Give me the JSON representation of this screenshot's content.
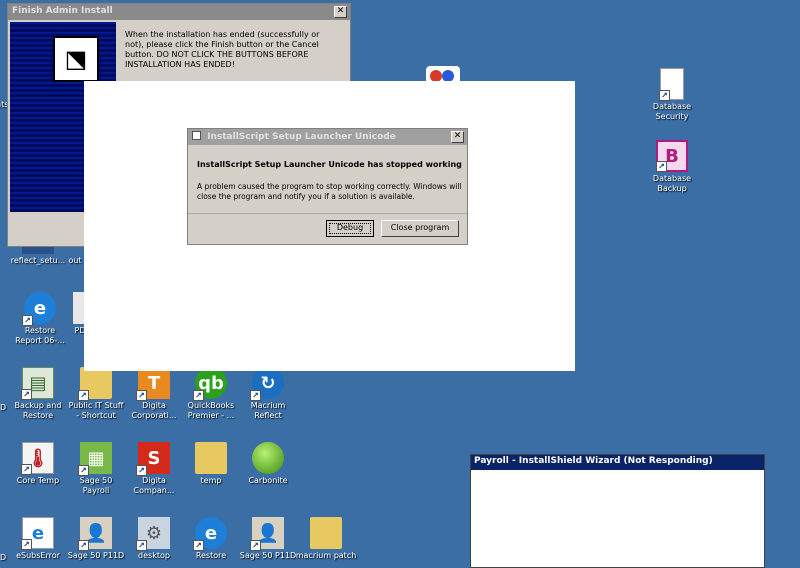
{
  "finish_window": {
    "title": "Finish Admin Install",
    "message": "When the installation has ended (successfully or not), please click the Finish button or the Cancel button.  DO NOT CLICK THE BUTTONS BEFORE INSTALLATION HAS ENDED!"
  },
  "error_dialog": {
    "title": "InstallScript Setup Launcher Unicode",
    "heading": "InstallScript Setup Launcher Unicode has stopped working",
    "body": "A problem caused the program to stop working correctly. Windows will close the program and notify you if a solution is available.",
    "debug_label": "Debug",
    "close_label": "Close program"
  },
  "wizard_window": {
    "title": "Payroll - InstallShield Wizard (Not Responding)"
  },
  "desktop_icons": [
    {
      "label": "reflect_setu..."
    },
    {
      "label": "out"
    },
    {
      "label": "Restore\nReport 06-..."
    },
    {
      "label": "PD"
    },
    {
      "label": "Backup and\nRestore"
    },
    {
      "label": "Public IT Stuff\n- Shortcut"
    },
    {
      "label": "Digita\nCorporati..."
    },
    {
      "label": "QuickBooks\nPremier - ..."
    },
    {
      "label": "Macrium\nReflect"
    },
    {
      "label": "Core Temp"
    },
    {
      "label": "Sage 50\nPayroll"
    },
    {
      "label": "Digita\nCompan..."
    },
    {
      "label": "temp"
    },
    {
      "label": "Carbonite"
    },
    {
      "label": "eSubsError"
    },
    {
      "label": "Sage 50 P11D"
    },
    {
      "label": "desktop"
    },
    {
      "label": "Restore"
    },
    {
      "label": "Sage 50 P11D"
    },
    {
      "label": "macrium patch"
    },
    {
      "label": "Database\nSecurity"
    },
    {
      "label": "Database\nBackup"
    },
    {
      "label": "nts"
    },
    {
      "label": "D"
    },
    {
      "label": "D"
    }
  ]
}
